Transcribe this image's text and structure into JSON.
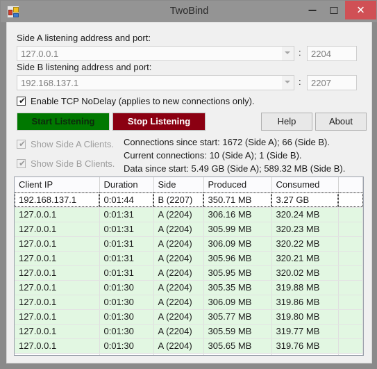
{
  "window": {
    "title": "TwoBind",
    "icon": "app-icon",
    "controls": {
      "minimize": "–",
      "maximize": "□",
      "close": "✕",
      "close_color": "#d05055"
    }
  },
  "form": {
    "side_a_label": "Side A listening address and port:",
    "side_a_address": "127.0.0.1",
    "side_a_port": "2204",
    "side_b_label": "Side B listening address and port:",
    "side_b_address": "192.168.137.1",
    "side_b_port": "2207",
    "colon": ":"
  },
  "options": {
    "nodelay_label": "Enable TCP NoDelay (applies to new connections only).",
    "nodelay_checked": "✔",
    "show_side_a_label": "Show Side A Clients.",
    "show_side_a_checked": "✔",
    "show_side_b_label": "Show Side B Clients.",
    "show_side_b_checked": "✔"
  },
  "buttons": {
    "start": "Start Listening",
    "start_bg": "#007800",
    "start_fg": "#0c2a0c",
    "stop": "Stop Listening",
    "stop_bg": "#8b0012",
    "stop_fg": "#ffffff",
    "help": "Help",
    "about": "About"
  },
  "stats": {
    "line1": "Connections since start: 1672 (Side A); 66 (Side B).",
    "line2": "Current connections: 10 (Side A); 1 (Side B).",
    "line3": "Data since start: 5.49 GB (Side A); 589.32 MB (Side B)."
  },
  "table": {
    "columns": [
      "Client IP",
      "Duration",
      "Side",
      "Produced",
      "Consumed",
      ""
    ],
    "rows": [
      {
        "ip": "192.168.137.1",
        "duration": "0:01:44",
        "side": "B (2207)",
        "produced": "350.71 MB",
        "consumed": "3.27 GB",
        "style": "white focus"
      },
      {
        "ip": "127.0.0.1",
        "duration": "0:01:31",
        "side": "A (2204)",
        "produced": "306.16 MB",
        "consumed": "320.24 MB",
        "style": "green"
      },
      {
        "ip": "127.0.0.1",
        "duration": "0:01:31",
        "side": "A (2204)",
        "produced": "305.99 MB",
        "consumed": "320.23 MB",
        "style": "green"
      },
      {
        "ip": "127.0.0.1",
        "duration": "0:01:31",
        "side": "A (2204)",
        "produced": "306.09 MB",
        "consumed": "320.22 MB",
        "style": "green"
      },
      {
        "ip": "127.0.0.1",
        "duration": "0:01:31",
        "side": "A (2204)",
        "produced": "305.96 MB",
        "consumed": "320.21 MB",
        "style": "green"
      },
      {
        "ip": "127.0.0.1",
        "duration": "0:01:31",
        "side": "A (2204)",
        "produced": "305.95 MB",
        "consumed": "320.02 MB",
        "style": "green"
      },
      {
        "ip": "127.0.0.1",
        "duration": "0:01:30",
        "side": "A (2204)",
        "produced": "305.35 MB",
        "consumed": "319.88 MB",
        "style": "green"
      },
      {
        "ip": "127.0.0.1",
        "duration": "0:01:30",
        "side": "A (2204)",
        "produced": "306.09 MB",
        "consumed": "319.86 MB",
        "style": "green"
      },
      {
        "ip": "127.0.0.1",
        "duration": "0:01:30",
        "side": "A (2204)",
        "produced": "305.77 MB",
        "consumed": "319.80 MB",
        "style": "green"
      },
      {
        "ip": "127.0.0.1",
        "duration": "0:01:30",
        "side": "A (2204)",
        "produced": "305.59 MB",
        "consumed": "319.77 MB",
        "style": "green"
      },
      {
        "ip": "127.0.0.1",
        "duration": "0:01:30",
        "side": "A (2204)",
        "produced": "305.65 MB",
        "consumed": "319.76 MB",
        "style": "green"
      },
      {
        "ip": "",
        "duration": "",
        "side": "",
        "produced": "",
        "consumed": "",
        "style": "empty"
      }
    ]
  }
}
